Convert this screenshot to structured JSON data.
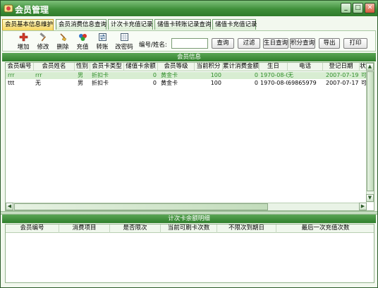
{
  "window": {
    "title": "会员管理",
    "min": "_",
    "max": "□",
    "close": "✕"
  },
  "tabs": [
    "会员基本信息维护",
    "会员消费信息查询",
    "计次卡充值记录",
    "储值卡转账记录查询",
    "储值卡充值记录"
  ],
  "toolbar": {
    "tools": [
      "增加",
      "修改",
      "删除",
      "充值",
      "转账",
      "改密码"
    ],
    "search_label": "编号/姓名:",
    "search_value": "",
    "buttons": [
      "查询",
      "过滤",
      "生日查询",
      "积分查询",
      "导出",
      "打印"
    ]
  },
  "member_section": {
    "title": "会员信息",
    "columns": [
      "会员编号",
      "会员姓名",
      "性别",
      "会员卡类型",
      "储值卡余额",
      "会员等级",
      "当前积分",
      "累计消费金额",
      "生日",
      "电话",
      "登记日期",
      "状"
    ],
    "rows": [
      [
        "rrr",
        "rrr",
        "男",
        "折扣卡",
        "0",
        "黄金卡",
        "100",
        "0",
        "1970-08-0",
        "无",
        "2007-07-19",
        "可"
      ],
      [
        "ttt",
        "无",
        "男",
        "折扣卡",
        "0",
        "黄金卡",
        "100",
        "0",
        "1970-08-0",
        "69865979",
        "2007-07-17",
        "可"
      ]
    ]
  },
  "count_section": {
    "title": "计次卡余额明细",
    "columns": [
      "会员编号",
      "消费项目",
      "是否限次",
      "当前可刷卡次数",
      "不限次到期日",
      "最后一次充值次数"
    ]
  },
  "colors": {
    "accent": "#3f8f3a",
    "selected_row": "#d8edd2",
    "selected_text": "#2f8d2a"
  }
}
